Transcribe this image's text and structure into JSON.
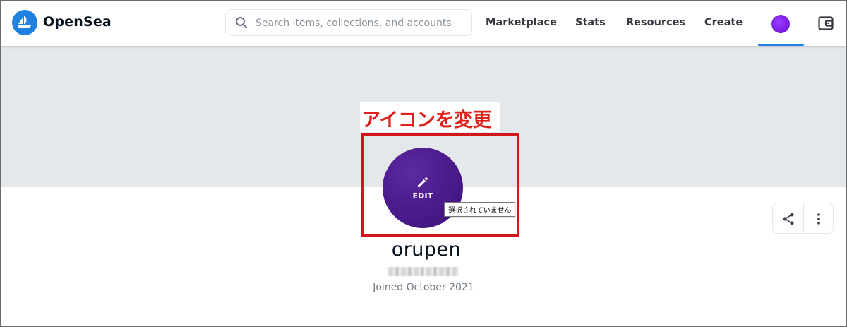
{
  "header": {
    "brand": "OpenSea",
    "search_placeholder": "Search items, collections, and accounts",
    "nav": [
      "Marketplace",
      "Stats",
      "Resources",
      "Create"
    ]
  },
  "annotation": {
    "label": "アイコンを変更",
    "color": "#e0201a"
  },
  "profile": {
    "avatar_action": "EDIT",
    "file_tooltip": "選択されていません",
    "username": "orupen",
    "joined": "Joined October 2021"
  },
  "colors": {
    "accent": "#2081e2",
    "avatar": "#4a1a8a",
    "banner": "#e5e8eb"
  },
  "icons": [
    "opensea-logo-icon",
    "search-icon",
    "wallet-icon",
    "pencil-icon",
    "share-icon",
    "more-icon"
  ]
}
